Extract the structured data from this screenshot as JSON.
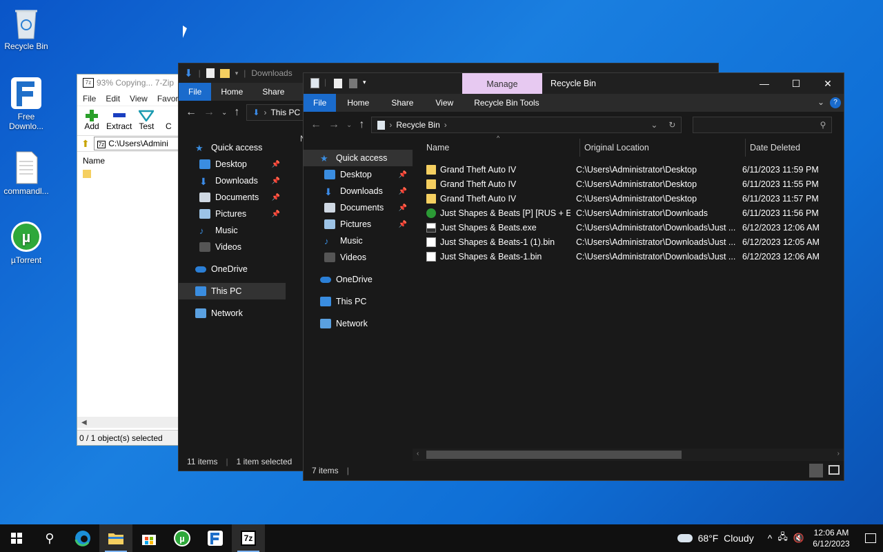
{
  "desktop": {
    "icons": [
      {
        "label": "Recycle Bin",
        "icon": "recycle-bin-icon"
      },
      {
        "label": "Free Downlo...",
        "icon": "free-download-manager-icon"
      },
      {
        "label": "commandl...",
        "icon": "text-file-icon"
      },
      {
        "label": "µTorrent",
        "icon": "utorrent-icon"
      }
    ]
  },
  "sevenzip": {
    "title": "93% Copying... 7-Zip",
    "app_badge": "7z",
    "menu": [
      "File",
      "Edit",
      "View",
      "Favori"
    ],
    "tools": [
      "Add",
      "Extract",
      "Test",
      "C"
    ],
    "path": "C:\\Users\\Admini",
    "column": "Name",
    "status": "0 / 1 object(s) selected"
  },
  "downloads": {
    "title": "Downloads",
    "tabs": [
      "File",
      "Home",
      "Share"
    ],
    "address": "This PC",
    "nav": [
      {
        "label": "Quick access",
        "icon": "star-icon"
      },
      {
        "label": "Desktop",
        "icon": "desktop-icon",
        "pinned": true
      },
      {
        "label": "Downloads",
        "icon": "download-arrow-icon",
        "pinned": true
      },
      {
        "label": "Documents",
        "icon": "documents-icon",
        "pinned": true
      },
      {
        "label": "Pictures",
        "icon": "pictures-icon",
        "pinned": true
      },
      {
        "label": "Music",
        "icon": "music-icon"
      },
      {
        "label": "Videos",
        "icon": "videos-icon"
      },
      {
        "label": "OneDrive",
        "icon": "cloud-icon"
      },
      {
        "label": "This PC",
        "icon": "computer-icon"
      },
      {
        "label": "Network",
        "icon": "network-icon"
      }
    ],
    "col_partial": "N",
    "status_items": "11 items",
    "status_selected": "1 item selected"
  },
  "recycle": {
    "context_tab": "Manage",
    "title": "Recycle Bin",
    "tabs": [
      "File",
      "Home",
      "Share",
      "View",
      "Recycle Bin Tools"
    ],
    "address": "Recycle Bin",
    "search_placeholder": "",
    "nav": [
      {
        "label": "Quick access"
      },
      {
        "label": "Desktop"
      },
      {
        "label": "Downloads"
      },
      {
        "label": "Documents"
      },
      {
        "label": "Pictures"
      },
      {
        "label": "Music"
      },
      {
        "label": "Videos"
      },
      {
        "label": "OneDrive"
      },
      {
        "label": "This PC"
      },
      {
        "label": "Network"
      }
    ],
    "columns": [
      "Name",
      "Original Location",
      "Date Deleted"
    ],
    "rows": [
      {
        "name": "Grand Theft Auto IV",
        "location": "C:\\Users\\Administrator\\Desktop",
        "date": "6/11/2023 11:59 PM",
        "icon": "folder-icon"
      },
      {
        "name": "Grand Theft Auto IV",
        "location": "C:\\Users\\Administrator\\Desktop",
        "date": "6/11/2023 11:55 PM",
        "icon": "folder-icon"
      },
      {
        "name": "Grand Theft Auto IV",
        "location": "C:\\Users\\Administrator\\Desktop",
        "date": "6/11/2023 11:57 PM",
        "icon": "folder-icon"
      },
      {
        "name": "Just Shapes & Beats [P] [RUS + EN...",
        "location": "C:\\Users\\Administrator\\Downloads",
        "date": "6/11/2023 11:56 PM",
        "icon": "utorrent-file-icon"
      },
      {
        "name": "Just Shapes & Beats.exe",
        "location": "C:\\Users\\Administrator\\Downloads\\Just ...",
        "date": "6/12/2023 12:06 AM",
        "icon": "exe-icon"
      },
      {
        "name": "Just Shapes & Beats-1 (1).bin",
        "location": "C:\\Users\\Administrator\\Downloads\\Just ...",
        "date": "6/12/2023 12:05 AM",
        "icon": "file-icon"
      },
      {
        "name": "Just Shapes & Beats-1.bin",
        "location": "C:\\Users\\Administrator\\Downloads\\Just ...",
        "date": "6/12/2023 12:06 AM",
        "icon": "file-icon"
      }
    ],
    "status": "7 items"
  },
  "taskbar": {
    "weather": "68°F  Cloudy",
    "time": "12:06 AM",
    "date": "6/12/2023",
    "apps": [
      "start-icon",
      "search-icon",
      "edge-icon",
      "file-explorer-icon",
      "store-icon",
      "utorrent-icon",
      "free-download-manager-icon",
      "7zip-icon"
    ]
  }
}
